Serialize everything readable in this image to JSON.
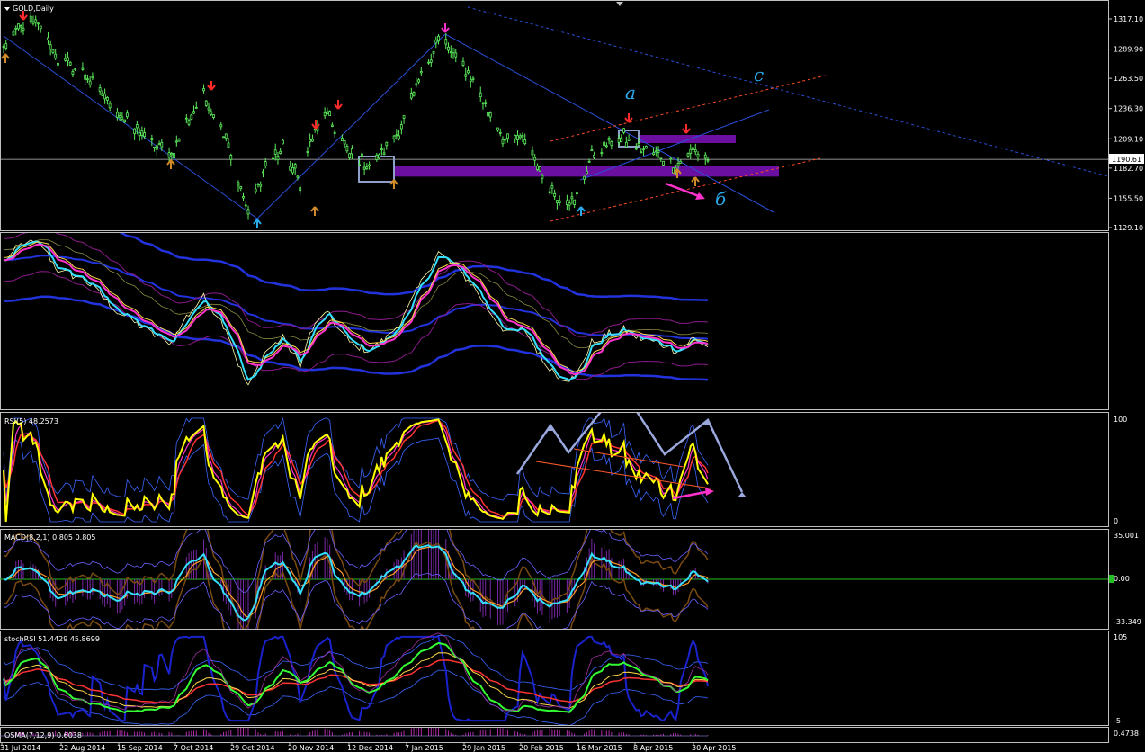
{
  "window": {
    "symbol_title": "GOLD,Daily"
  },
  "colors": {
    "bg": "#000000",
    "grid": "#3c3c3c",
    "candle": "#5df15d",
    "blue_line": "#2a4fd8",
    "zone": "#6a0fa0",
    "wave_label": "#29a8e8",
    "magenta": "#ff33cc",
    "yellow": "#ffff00",
    "cyan": "#33e0ff",
    "red_arrow": "#ff2a2a",
    "orange_arrow": "#d08a2a"
  },
  "current_price": "1190.61",
  "wave_labels": {
    "a": "a",
    "b": "б",
    "c": "c"
  },
  "chart_data": [
    {
      "type": "candlestick",
      "panel": "price",
      "title": "GOLD,Daily",
      "price_ticks": [
        "1317.10",
        "1289.90",
        "1263.50",
        "1236.30",
        "1209.10",
        "1182.70",
        "1155.50",
        "1129.10"
      ],
      "ylim": [
        1129.1,
        1317.1
      ],
      "x_dates": [
        "31 Jul 2014",
        "22 Aug 2014",
        "15 Sep 2014",
        "7 Oct 2014",
        "29 Oct 2014",
        "20 Nov 2014",
        "12 Dec 2014",
        "7 Jan 2015",
        "29 Jan 2015",
        "20 Feb 2015",
        "16 Mar 2015",
        "8 Apr 2015",
        "30 Apr 2015"
      ],
      "approx_close_path": [
        [
          "2014-07-31",
          1290
        ],
        [
          "2014-08-08",
          1312
        ],
        [
          "2014-08-15",
          1310
        ],
        [
          "2014-08-22",
          1280
        ],
        [
          "2014-09-02",
          1268
        ],
        [
          "2014-09-15",
          1232
        ],
        [
          "2014-09-29",
          1205
        ],
        [
          "2014-10-07",
          1195
        ],
        [
          "2014-10-13",
          1225
        ],
        [
          "2014-10-20",
          1248
        ],
        [
          "2014-10-29",
          1212
        ],
        [
          "2014-11-03",
          1170
        ],
        [
          "2014-11-07",
          1142
        ],
        [
          "2014-11-14",
          1185
        ],
        [
          "2014-11-21",
          1200
        ],
        [
          "2014-11-28",
          1170
        ],
        [
          "2014-12-02",
          1205
        ],
        [
          "2014-12-08",
          1232
        ],
        [
          "2014-12-12",
          1218
        ],
        [
          "2014-12-18",
          1195
        ],
        [
          "2014-12-26",
          1185
        ],
        [
          "2015-01-02",
          1200
        ],
        [
          "2015-01-08",
          1220
        ],
        [
          "2015-01-16",
          1265
        ],
        [
          "2015-01-23",
          1300
        ],
        [
          "2015-01-29",
          1285
        ],
        [
          "2015-02-05",
          1265
        ],
        [
          "2015-02-13",
          1230
        ],
        [
          "2015-02-20",
          1205
        ],
        [
          "2015-02-27",
          1210
        ],
        [
          "2015-03-06",
          1175
        ],
        [
          "2015-03-13",
          1155
        ],
        [
          "2015-03-19",
          1152
        ],
        [
          "2015-03-26",
          1195
        ],
        [
          "2015-04-02",
          1205
        ],
        [
          "2015-04-08",
          1210
        ],
        [
          "2015-04-14",
          1200
        ],
        [
          "2015-04-22",
          1195
        ],
        [
          "2015-04-30",
          1185
        ],
        [
          "2015-05-06",
          1200
        ],
        [
          "2015-05-12",
          1190.61
        ]
      ],
      "zone_level_low": 1175,
      "zone_level_high": 1185
    },
    {
      "type": "line",
      "panel": "bands",
      "series": [
        {
          "name": "",
          "values": []
        }
      ]
    },
    {
      "type": "line",
      "panel": "rsi",
      "title": "RSI(5) 48.2573",
      "ticks": [
        "100",
        "0"
      ],
      "ylim": [
        0,
        100
      ]
    },
    {
      "type": "histogram",
      "panel": "macd",
      "title": "MACD(8,2,1) 0.805 0.805",
      "ticks": [
        "35.001",
        "0.00",
        "-33.349"
      ]
    },
    {
      "type": "line",
      "panel": "stochrsi",
      "title": "stochRSI 51.4429 45.8699",
      "ticks": [
        "105",
        "-5"
      ]
    },
    {
      "type": "histogram",
      "panel": "osma",
      "title": "OSMA(7,12,9) 0.6038",
      "ticks": [
        "0.4738"
      ]
    }
  ]
}
